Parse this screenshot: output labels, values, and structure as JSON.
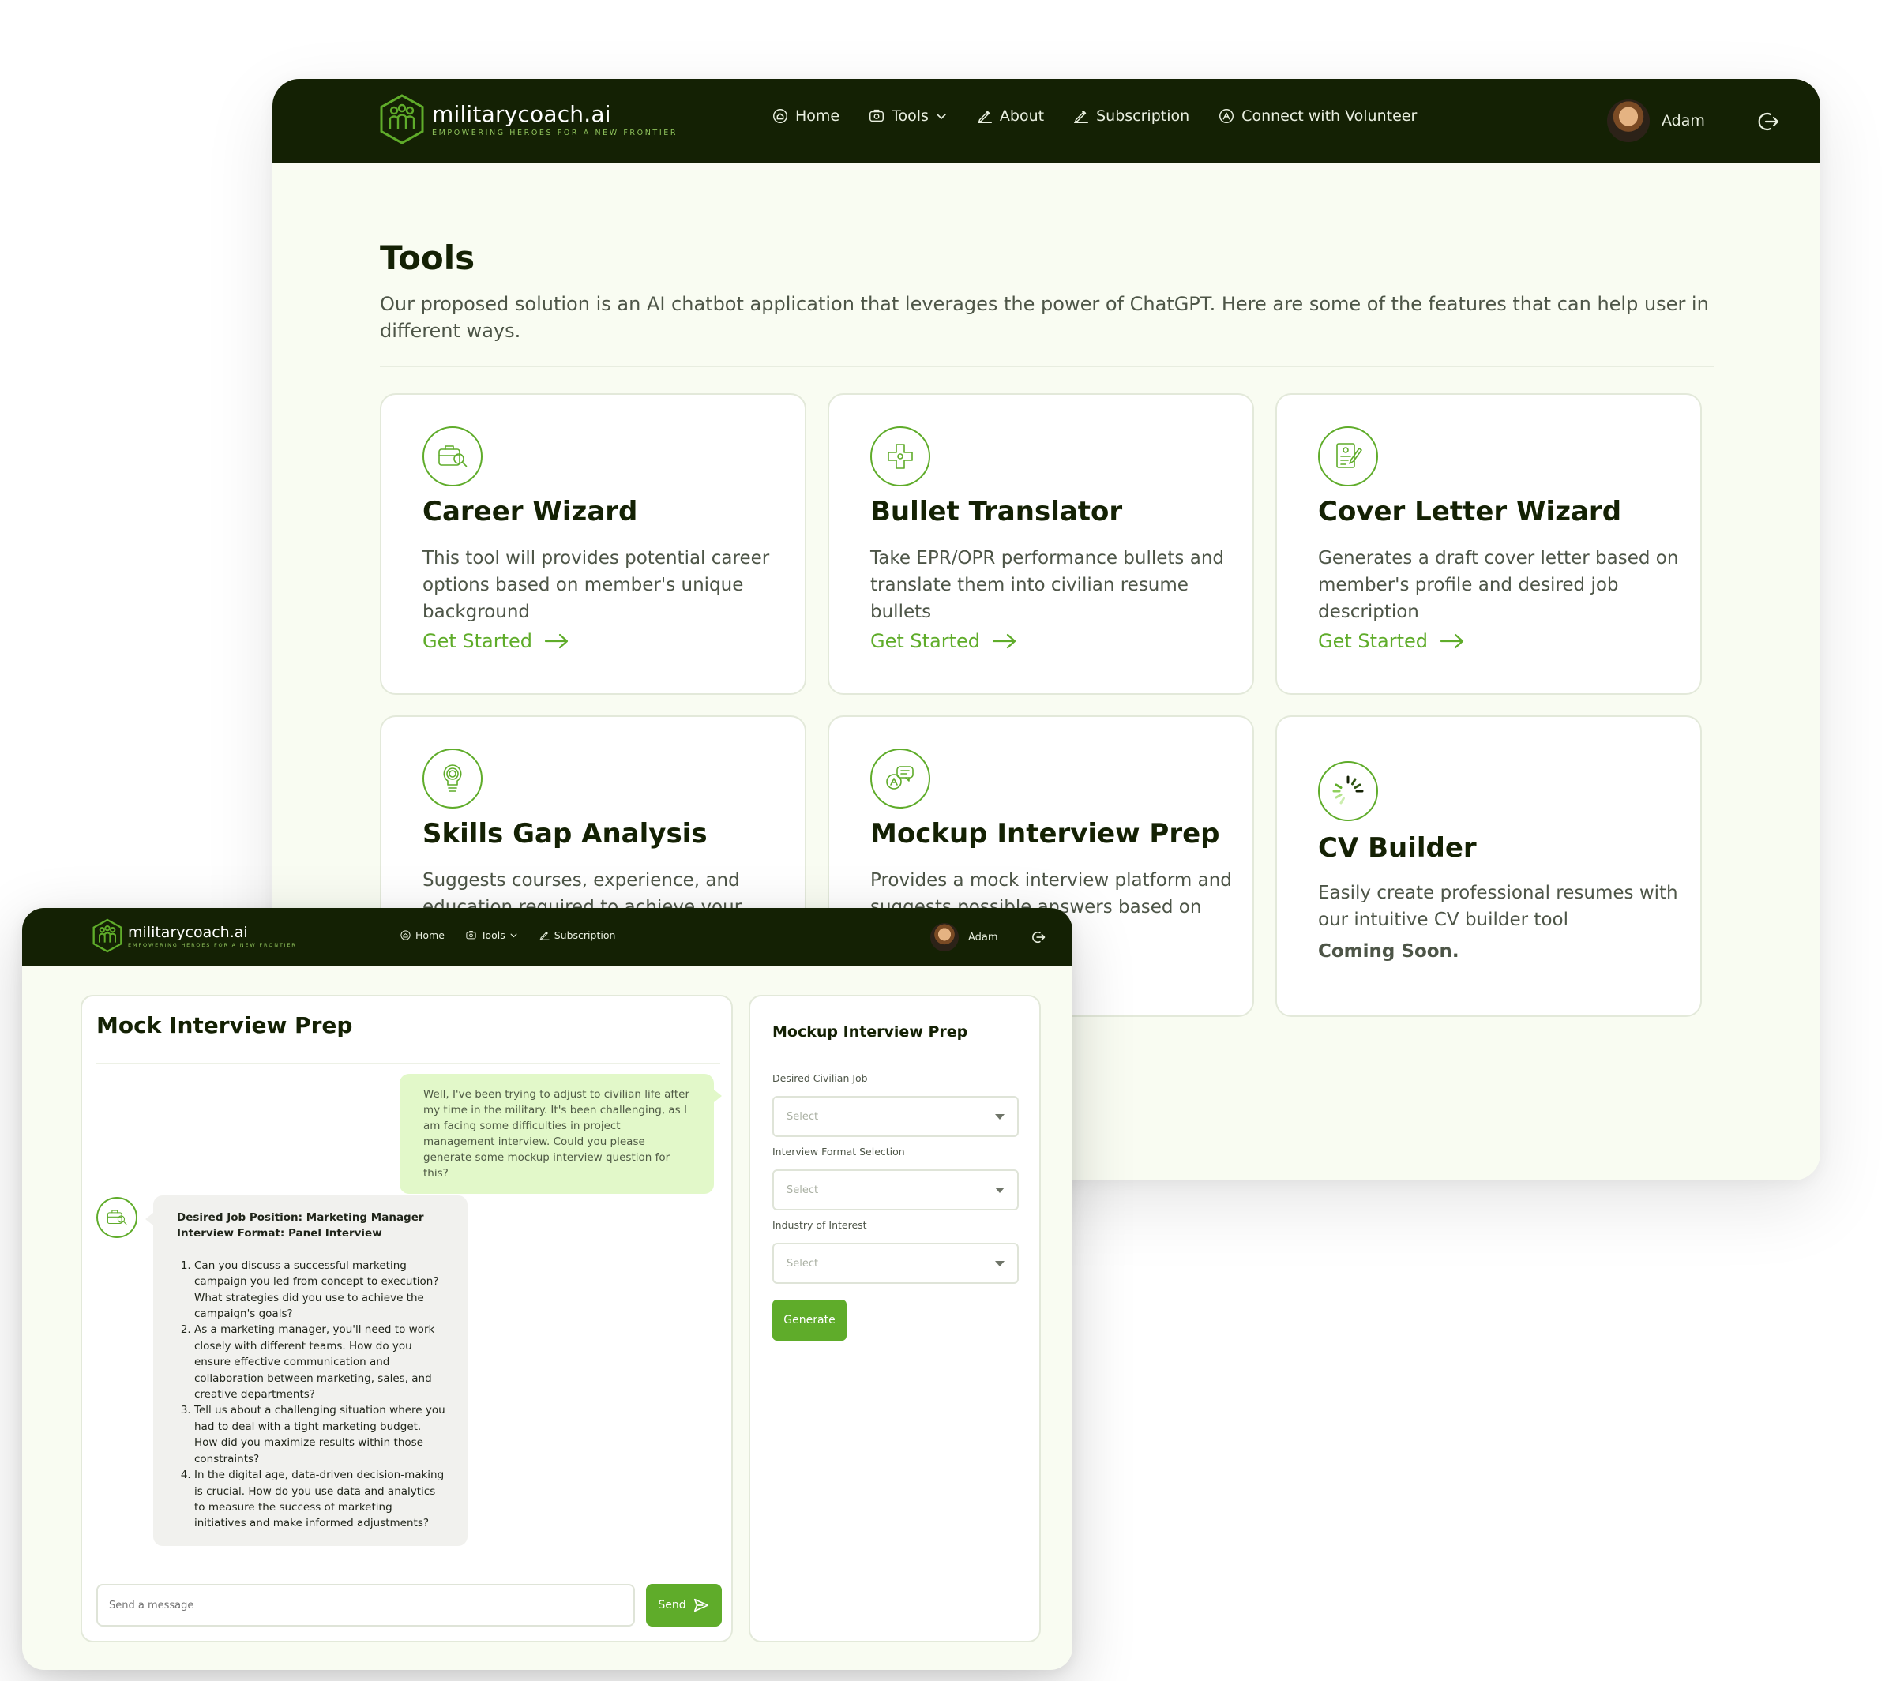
{
  "brand": {
    "name": "militarycoach.ai",
    "tagline": "EMPOWERING HEROES FOR A NEW FRONTIER"
  },
  "nav": {
    "home": "Home",
    "tools": "Tools",
    "about": "About",
    "subscription": "Subscription",
    "connect": "Connect with Volunteer"
  },
  "user": {
    "name": "Adam"
  },
  "tools_page": {
    "title": "Tools",
    "description": "Our proposed solution is an AI chatbot application that leverages the power of ChatGPT. Here are some of the features that can help user in different ways.",
    "cta_label": "Get Started",
    "cards": [
      {
        "icon": "briefcase-search-icon",
        "title": "Career Wizard",
        "description": "This tool will provides potential career options based on member's unique background"
      },
      {
        "icon": "puzzle-icon",
        "title": "Bullet Translator",
        "description": "Take EPR/OPR performance bullets and translate them into civilian resume bullets"
      },
      {
        "icon": "document-edit-icon",
        "title": "Cover Letter Wizard",
        "description": "Generates a draft cover letter based on member's profile and desired job description"
      },
      {
        "icon": "lightbulb-icon",
        "title": "Skills Gap Analysis",
        "description": "Suggests courses, experience, and education required to achieve your"
      },
      {
        "icon": "chat-bubbles-icon",
        "title": "Mockup Interview Prep",
        "description": "Provides a mock interview platform and suggests possible answers based on background."
      },
      {
        "icon": "loader-icon",
        "title": "CV Builder",
        "description": "Easily create professional resumes with our intuitive CV builder tool",
        "status": "Coming Soon."
      }
    ]
  },
  "mock_interview": {
    "title": "Mock Interview Prep",
    "user_message": "Well, I've been trying to adjust to civilian life after my time in the military. It's been challenging, as I am facing some difficulties in project management interview. Could you please generate some mockup interview question for this?",
    "bot_header_1": "Desired Job Position: Marketing Manager",
    "bot_header_2": "Interview Format: Panel Interview",
    "questions": [
      "Can you discuss a successful marketing campaign you led from concept to execution? What strategies did you use to achieve the campaign's goals?",
      "As a marketing manager, you'll need to work closely with different teams. How do you ensure effective communication and collaboration between marketing, sales, and creative departments?",
      "Tell us about a challenging situation where you had to deal with a tight marketing budget. How did you maximize results within those constraints?",
      "In the digital age, data-driven decision-making is crucial. How do you use data and analytics to measure the success of marketing initiatives and make informed adjustments?"
    ],
    "input_placeholder": "Send a message",
    "send_label": "Send"
  },
  "form": {
    "title": "Mockup Interview Prep",
    "job_label": "Desired Civilian Job",
    "format_label": "Interview Format Selection",
    "industry_label": "Industry of Interest",
    "select_placeholder": "Select",
    "generate_label": "Generate"
  },
  "colors": {
    "nav_bg": "#142104",
    "accent": "#5fac2a",
    "page_bg": "#f9fcf2",
    "user_bubble": "#e2f8c9"
  }
}
